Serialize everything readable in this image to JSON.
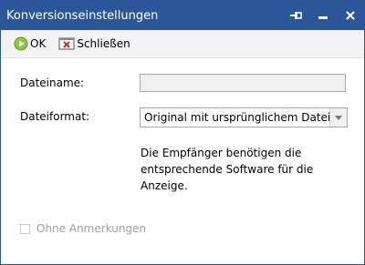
{
  "window": {
    "title": "Konversionseinstellungen"
  },
  "toolbar": {
    "ok_label": "OK",
    "close_label": "Schließen"
  },
  "form": {
    "filename_label": "Dateiname:",
    "filename_value": "",
    "format_label": "Dateiformat:",
    "format_value": "Original mit ursprünglichem Dateiname",
    "info_text": "Die Empfänger benötigen die entsprechende Software für die Anzeige.",
    "no_annotations_label": "Ohne Anmerkungen",
    "no_annotations_checked": false
  },
  "colors": {
    "titlebar": "#2b579a",
    "ok_icon": "#8dc63f",
    "close_icon": "#d9251c"
  }
}
